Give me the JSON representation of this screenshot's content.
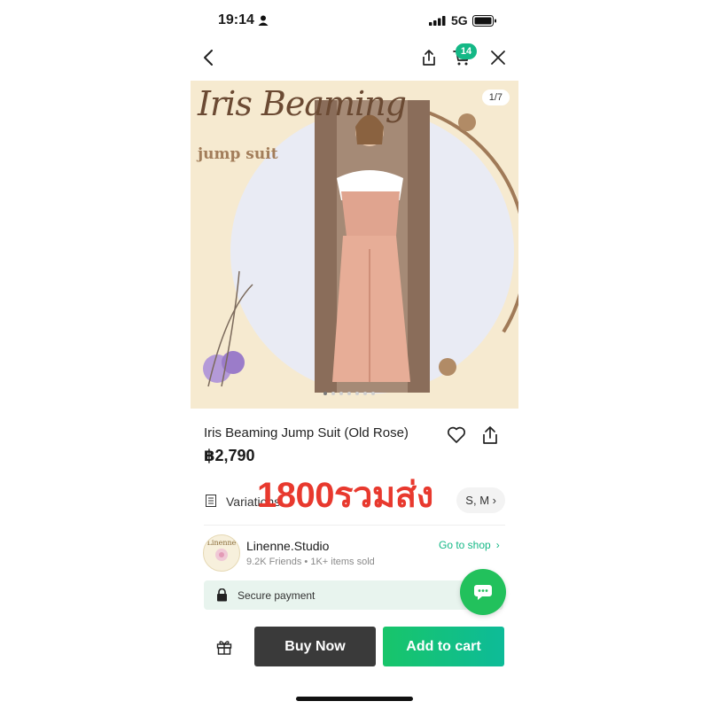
{
  "status_bar": {
    "time": "19:14",
    "network": "5G"
  },
  "nav": {
    "cart_count": "14"
  },
  "image": {
    "counter": "1/7",
    "title": "Iris Beaming",
    "subtitle": "jump suit",
    "dots_total": 7,
    "dots_active": 0,
    "bg_color": "#f6ead0"
  },
  "product": {
    "title": "Iris Beaming Jump Suit (Old Rose)",
    "price": "฿2,790",
    "overlay_text": "1800รวมส่ง"
  },
  "variations": {
    "label": "Variations",
    "value": "S, M"
  },
  "shop": {
    "logo_text": "Linenne",
    "name": "Linenne.Studio",
    "meta": "9.2K Friends • 1K+ items sold",
    "go_label": "Go to shop"
  },
  "secure": {
    "label": "Secure payment"
  },
  "actions": {
    "buy_now": "Buy Now",
    "add_to_cart": "Add to cart"
  },
  "colors": {
    "accent": "#14b886",
    "chat_green": "#22c15c",
    "overlay_red": "#e8392e",
    "buy_dark": "#3a3a3a"
  },
  "icons": [
    "person-icon",
    "signal-icon",
    "battery-icon",
    "back-icon",
    "share-icon",
    "cart-icon",
    "close-icon",
    "heart-icon",
    "variations-icon",
    "chevron-right-icon",
    "lock-icon",
    "chat-icon",
    "gift-icon"
  ]
}
